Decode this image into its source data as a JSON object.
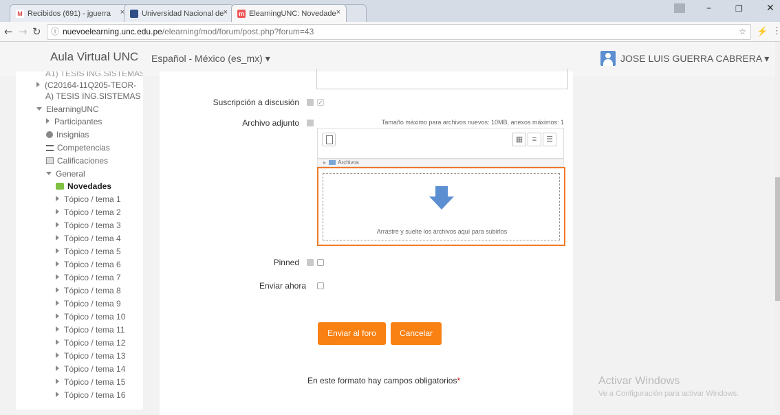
{
  "browser": {
    "tabs": [
      {
        "title": "Recibidos (691) - jguerra"
      },
      {
        "title": "Universidad Nacional de"
      },
      {
        "title": "ElearningUNC: Novedade"
      }
    ],
    "close_glyph": "×",
    "url_host": "nuevoelearning.unc.edu.pe",
    "url_path": "/elearning/mod/forum/post.php?forum=43"
  },
  "navbar": {
    "site_name": "Aula Virtual UNC",
    "language": "Español - México (es_mx) ▾",
    "user": "JOSE LUIS GUERRA CABRERA ▾"
  },
  "sidebar": {
    "items": [
      {
        "label": "A1) TESIS ING.SISTEMAS"
      },
      {
        "label": "(C20164-11Q205-TEOR-"
      },
      {
        "label": "A) TESIS ING.SISTEMAS"
      },
      {
        "label": "ElearningUNC"
      },
      {
        "label": "Participantes"
      },
      {
        "label": "Insignias"
      },
      {
        "label": "Competencias"
      },
      {
        "label": "Calificaciones"
      },
      {
        "label": "General"
      },
      {
        "label": "Novedades"
      },
      {
        "label": "Tópico / tema 1"
      },
      {
        "label": "Tópico / tema 2"
      },
      {
        "label": "Tópico / tema 3"
      },
      {
        "label": "Tópico / tema 4"
      },
      {
        "label": "Tópico / tema 5"
      },
      {
        "label": "Tópico / tema 6"
      },
      {
        "label": "Tópico / tema 7"
      },
      {
        "label": "Tópico / tema 8"
      },
      {
        "label": "Tópico / tema 9"
      },
      {
        "label": "Tópico / tema 10"
      },
      {
        "label": "Tópico / tema 11"
      },
      {
        "label": "Tópico / tema 12"
      },
      {
        "label": "Tópico / tema 13"
      },
      {
        "label": "Tópico / tema 14"
      },
      {
        "label": "Tópico / tema 15"
      },
      {
        "label": "Tópico / tema 16"
      }
    ]
  },
  "form": {
    "subscription_label": "Suscripción a discusión",
    "attachment_label": "Archivo adjunto",
    "max_size_text": "Tamaño máximo para archivos nuevos: 10MB, anexos máximos: 1",
    "folder_label": "Archivos",
    "drop_text": "Arrastre y suelte los archivos aquí para subirlos",
    "pinned_label": "Pinned",
    "send_now_label": "Enviar ahora",
    "submit_label": "Enviar al foro",
    "cancel_label": "Cancelar",
    "required_note": "En este formato hay campos obligatorios",
    "required_star": "*"
  },
  "watermark": {
    "line1": "Activar Windows",
    "line2": "Ve a Configuración para activar Windows."
  },
  "colors": {
    "accent": "#f98012",
    "drop_border": "#f07a28",
    "arrow": "#5b8fd1"
  }
}
